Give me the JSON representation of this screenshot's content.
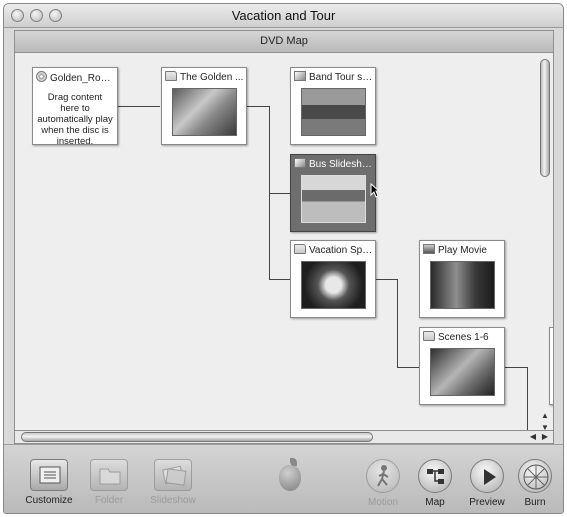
{
  "window": {
    "title": "Vacation and Tour"
  },
  "panel": {
    "title": "DVD Map"
  },
  "nodes": {
    "disc": {
      "title": "Golden_Road...",
      "note": "Drag content here to automatically play when the disc is inserted."
    },
    "folder_golden": {
      "title": "The Golden ..."
    },
    "band_tour": {
      "title": "Band Tour sli..."
    },
    "bus_slideshow": {
      "title": "Bus Slideshow"
    },
    "vacation": {
      "title": "Vacation Spri..."
    },
    "play_movie": {
      "title": "Play Movie"
    },
    "scenes": {
      "title": "Scenes 1-6"
    }
  },
  "scroll": {
    "up_arrow": "▲",
    "down_arrow": "▼",
    "left_arrow": "◀",
    "right_arrow": "▶"
  },
  "toolbar": {
    "customize": "Customize",
    "folder": "Folder",
    "slideshow": "Slideshow",
    "motion": "Motion",
    "map": "Map",
    "preview": "Preview",
    "burn": "Burn"
  },
  "icons": {
    "customize": "grid-icon",
    "folder": "folder-icon",
    "slideshow": "slideshow-icon",
    "motion": "walking-person-icon",
    "map": "map-icon",
    "preview": "play-icon",
    "burn": "burn-icon",
    "logo": "apple-logo"
  }
}
